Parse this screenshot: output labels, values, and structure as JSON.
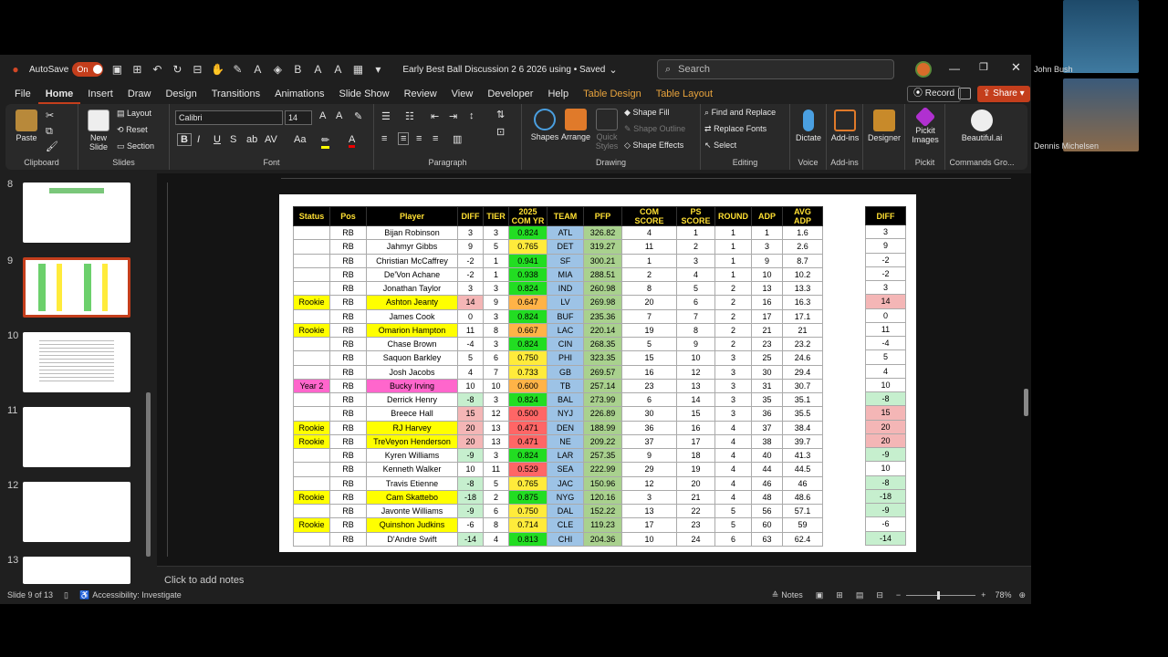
{
  "titlebar": {
    "autosave": "AutoSave",
    "toggle": "On",
    "doc_title": "Early Best Ball Discussion 2 6 2026 using  •  Saved",
    "search_placeholder": "Search"
  },
  "menu": [
    "File",
    "Home",
    "Insert",
    "Draw",
    "Design",
    "Transitions",
    "Animations",
    "Slide Show",
    "Review",
    "View",
    "Developer",
    "Help",
    "Table Design",
    "Table Layout"
  ],
  "actions": {
    "record": "Record",
    "share": "Share"
  },
  "ribbon": {
    "clipboard": {
      "label": "Clipboard",
      "paste": "Paste"
    },
    "slides": {
      "label": "Slides",
      "new_slide": "New Slide",
      "layout": "Layout",
      "reset": "Reset",
      "section": "Section"
    },
    "font": {
      "label": "Font",
      "family": "Calibri",
      "size": "14"
    },
    "paragraph": {
      "label": "Paragraph"
    },
    "drawing": {
      "label": "Drawing",
      "shapes": "Shapes",
      "arrange": "Arrange",
      "quick_styles": "Quick Styles",
      "shape_fill": "Shape Fill",
      "shape_outline": "Shape Outline",
      "shape_effects": "Shape Effects"
    },
    "editing": {
      "label": "Editing",
      "find_replace": "Find and Replace",
      "replace_fonts": "Replace Fonts",
      "select": "Select"
    },
    "voice": {
      "label": "Voice",
      "dictate": "Dictate"
    },
    "addins": {
      "label": "Add-ins",
      "addins": "Add-ins"
    },
    "designer": {
      "designer": "Designer"
    },
    "pickit": {
      "label": "Pickit",
      "pickit_images": "Pickit Images"
    },
    "commands": {
      "label": "Commands Gro...",
      "beautiful": "Beautiful.ai"
    }
  },
  "slide_numbers": [
    "8",
    "9",
    "10",
    "11",
    "12",
    "13"
  ],
  "notes_placeholder": "Click to add notes",
  "statusbar": {
    "slide": "Slide 9 of 13",
    "accessibility": "Accessibility: Investigate",
    "notes": "Notes",
    "zoom": "78%"
  },
  "participants": [
    "John Bush",
    "Dennis Michelsen"
  ],
  "table": {
    "headers": [
      "Status",
      "Pos",
      "Player",
      "DIFF",
      "TIER",
      "2025 COM YR",
      "TEAM",
      "PFP",
      "COM SCORE",
      "PS SCORE",
      "ROUND",
      "ADP",
      "AVG ADP"
    ],
    "rows": [
      [
        "",
        "RB",
        "Bijan Robinson",
        "3",
        "3",
        "0.824",
        "ATL",
        "326.82",
        "4",
        "1",
        "1",
        "1",
        "1.6"
      ],
      [
        "",
        "RB",
        "Jahmyr Gibbs",
        "9",
        "5",
        "0.765",
        "DET",
        "319.27",
        "11",
        "2",
        "1",
        "3",
        "2.6"
      ],
      [
        "",
        "RB",
        "Christian McCaffrey",
        "-2",
        "1",
        "0.941",
        "SF",
        "300.21",
        "1",
        "3",
        "1",
        "9",
        "8.7"
      ],
      [
        "",
        "RB",
        "De'Von Achane",
        "-2",
        "1",
        "0.938",
        "MIA",
        "288.51",
        "2",
        "4",
        "1",
        "10",
        "10.2"
      ],
      [
        "",
        "RB",
        "Jonathan Taylor",
        "3",
        "3",
        "0.824",
        "IND",
        "260.98",
        "8",
        "5",
        "2",
        "13",
        "13.3"
      ],
      [
        "Rookie",
        "RB",
        "Ashton Jeanty",
        "14",
        "9",
        "0.647",
        "LV",
        "269.98",
        "20",
        "6",
        "2",
        "16",
        "16.3"
      ],
      [
        "",
        "RB",
        "James Cook",
        "0",
        "3",
        "0.824",
        "BUF",
        "235.36",
        "7",
        "7",
        "2",
        "17",
        "17.1"
      ],
      [
        "Rookie",
        "RB",
        "Omarion Hampton",
        "11",
        "8",
        "0.667",
        "LAC",
        "220.14",
        "19",
        "8",
        "2",
        "21",
        "21"
      ],
      [
        "",
        "RB",
        "Chase Brown",
        "-4",
        "3",
        "0.824",
        "CIN",
        "268.35",
        "5",
        "9",
        "2",
        "23",
        "23.2"
      ],
      [
        "",
        "RB",
        "Saquon Barkley",
        "5",
        "6",
        "0.750",
        "PHI",
        "323.35",
        "15",
        "10",
        "3",
        "25",
        "24.6"
      ],
      [
        "",
        "RB",
        "Josh Jacobs",
        "4",
        "7",
        "0.733",
        "GB",
        "269.57",
        "16",
        "12",
        "3",
        "30",
        "29.4"
      ],
      [
        "Year 2",
        "RB",
        "Bucky Irving",
        "10",
        "10",
        "0.600",
        "TB",
        "257.14",
        "23",
        "13",
        "3",
        "31",
        "30.7"
      ],
      [
        "",
        "RB",
        "Derrick Henry",
        "-8",
        "3",
        "0.824",
        "BAL",
        "273.99",
        "6",
        "14",
        "3",
        "35",
        "35.1"
      ],
      [
        "",
        "RB",
        "Breece Hall",
        "15",
        "12",
        "0.500",
        "NYJ",
        "226.89",
        "30",
        "15",
        "3",
        "36",
        "35.5"
      ],
      [
        "Rookie",
        "RB",
        "RJ Harvey",
        "20",
        "13",
        "0.471",
        "DEN",
        "188.99",
        "36",
        "16",
        "4",
        "37",
        "38.4"
      ],
      [
        "Rookie",
        "RB",
        "TreVeyon Henderson",
        "20",
        "13",
        "0.471",
        "NE",
        "209.22",
        "37",
        "17",
        "4",
        "38",
        "39.7"
      ],
      [
        "",
        "RB",
        "Kyren Williams",
        "-9",
        "3",
        "0.824",
        "LAR",
        "257.35",
        "9",
        "18",
        "4",
        "40",
        "41.3"
      ],
      [
        "",
        "RB",
        "Kenneth Walker",
        "10",
        "11",
        "0.529",
        "SEA",
        "222.99",
        "29",
        "19",
        "4",
        "44",
        "44.5"
      ],
      [
        "",
        "RB",
        "Travis Etienne",
        "-8",
        "5",
        "0.765",
        "JAC",
        "150.96",
        "12",
        "20",
        "4",
        "46",
        "46"
      ],
      [
        "Rookie",
        "RB",
        "Cam Skattebo",
        "-18",
        "2",
        "0.875",
        "NYG",
        "120.16",
        "3",
        "21",
        "4",
        "48",
        "48.6"
      ],
      [
        "",
        "RB",
        "Javonte Williams",
        "-9",
        "6",
        "0.750",
        "DAL",
        "152.22",
        "13",
        "22",
        "5",
        "56",
        "57.1"
      ],
      [
        "Rookie",
        "RB",
        "Quinshon Judkins",
        "-6",
        "8",
        "0.714",
        "CLE",
        "119.23",
        "17",
        "23",
        "5",
        "60",
        "59"
      ],
      [
        "",
        "RB",
        "D'Andre Swift",
        "-14",
        "4",
        "0.813",
        "CHI",
        "204.36",
        "10",
        "24",
        "6",
        "63",
        "62.4"
      ]
    ],
    "diff_header": "DIFF",
    "colors": {
      "rookie": "#ffff00",
      "year2": "#ff66cc",
      "team": "#9dc3e6",
      "pfp": "#a9d18e",
      "pos_diff": "#f4b6b6",
      "neg_diff": "#c6efce",
      "com_high": "#22dd22",
      "com_mid": "#ffeb3b",
      "com_low": "#ff6666"
    }
  }
}
